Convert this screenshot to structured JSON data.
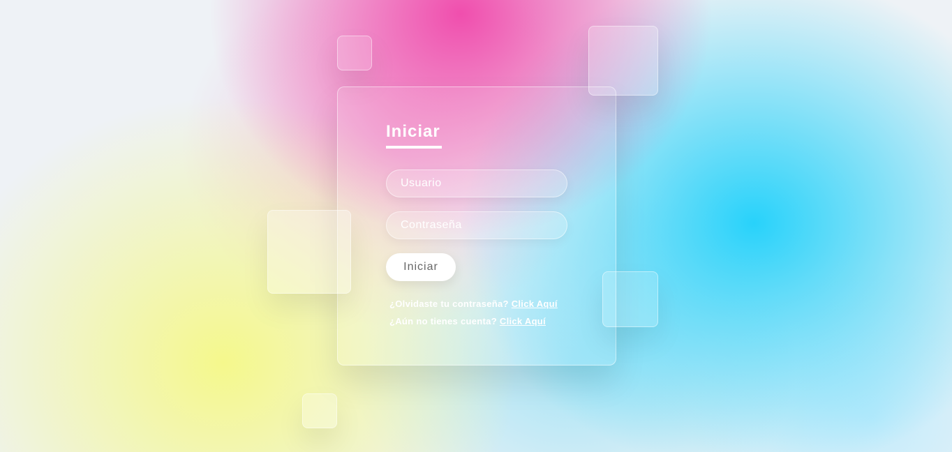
{
  "login": {
    "title": "Iniciar",
    "username_placeholder": "Usuario",
    "password_placeholder": "Contraseña",
    "submit_label": "Iniciar",
    "forgot_text": "¿Olvidaste tu contraseña?",
    "forgot_link": "Click Aquí",
    "signup_text": "¿Aún no tienes cuenta?",
    "signup_link": "Click Aquí"
  },
  "colors": {
    "background_pink": "#f046aa",
    "background_yellow": "#f5f88c",
    "background_cyan": "#28d2fa",
    "button_background": "#ffffff",
    "button_text": "#666666",
    "text": "#ffffff"
  }
}
